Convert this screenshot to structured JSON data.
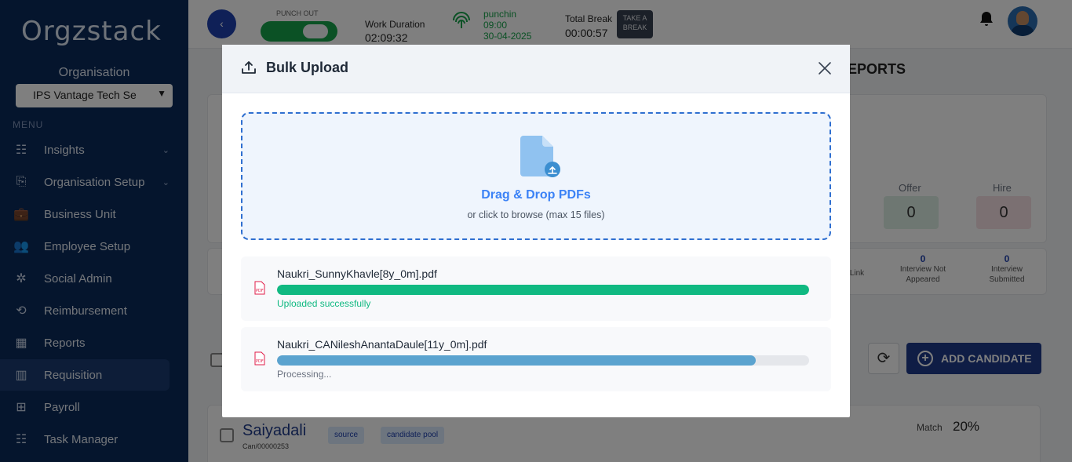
{
  "sidebar": {
    "logo": "Orgzstack",
    "org_label": "Organisation",
    "org_select_value": "IPS Vantage Tech Se",
    "menu_label": "MENU",
    "items": [
      {
        "label": "Insights",
        "icon": "insights-icon",
        "glyph": "☷",
        "has_caret": true
      },
      {
        "label": "Organisation Setup",
        "icon": "organisation-setup-icon",
        "glyph": "⎘",
        "has_caret": true
      },
      {
        "label": "Business Unit",
        "icon": "briefcase-icon",
        "glyph": "💼",
        "has_caret": false
      },
      {
        "label": "Employee Setup",
        "icon": "employee-setup-icon",
        "glyph": "👥",
        "has_caret": false
      },
      {
        "label": "Social Admin",
        "icon": "social-admin-icon",
        "glyph": "✲",
        "has_caret": false
      },
      {
        "label": "Reimbursement",
        "icon": "reimbursement-icon",
        "glyph": "⟲",
        "has_caret": false
      },
      {
        "label": "Reports",
        "icon": "reports-icon",
        "glyph": "▦",
        "has_caret": false
      },
      {
        "label": "Requisition",
        "icon": "requisition-icon",
        "glyph": "▥",
        "has_caret": false
      },
      {
        "label": "Payroll",
        "icon": "payroll-icon",
        "glyph": "⊞",
        "has_caret": false
      },
      {
        "label": "Task Manager",
        "icon": "task-manager-icon",
        "glyph": "☷",
        "has_caret": false
      }
    ]
  },
  "topbar": {
    "back_label": "‹",
    "punch_label": "PUNCH OUT",
    "work_duration_label": "Work Duration",
    "work_duration_value": "02:09:32",
    "punchin_label": "punchin",
    "punchin_time": "09:00",
    "punchin_date": "30-04-2025",
    "total_break_label": "Total Break",
    "total_break_value": "00:00:57",
    "take_break_line1": "TAKE A",
    "take_break_line2": "BREAK"
  },
  "main": {
    "title_partial": "EPORTS",
    "stats": [
      {
        "label": "Offer",
        "value": "0",
        "color": "#dcefe4"
      },
      {
        "label": "Hire",
        "value": "0",
        "color": "#f6e0e4"
      }
    ],
    "mini_stats": [
      {
        "num": "",
        "line1": "Link",
        "line2": ""
      },
      {
        "num": "0",
        "line1": "Interview Not",
        "line2": "Appeared"
      },
      {
        "num": "0",
        "line1": "Interview",
        "line2": "Submitted"
      }
    ],
    "add_candidate_label": "ADD CANDIDATE",
    "candidate": {
      "name": "Saiyadali",
      "id": "Can/00000253",
      "tags": [
        "source",
        "candidate pool"
      ],
      "match_label": "Match",
      "match_value": "20%"
    }
  },
  "modal": {
    "title": "Bulk Upload",
    "dropzone_title": "Drag & Drop PDFs",
    "dropzone_subtitle": "or click to browse (max 15 files)",
    "files": [
      {
        "name": "Naukri_SunnyKhavle[8y_0m].pdf",
        "progress": 1.0,
        "status": "Uploaded successfully",
        "bar_color": "#10b981",
        "status_color": "#10b981"
      },
      {
        "name": "Naukri_CANileshAnantaDaule[11y_0m].pdf",
        "progress": 0.9,
        "status": "Processing...",
        "bar_color": "#5ba3cf",
        "status_color": "#6b7280"
      }
    ]
  }
}
